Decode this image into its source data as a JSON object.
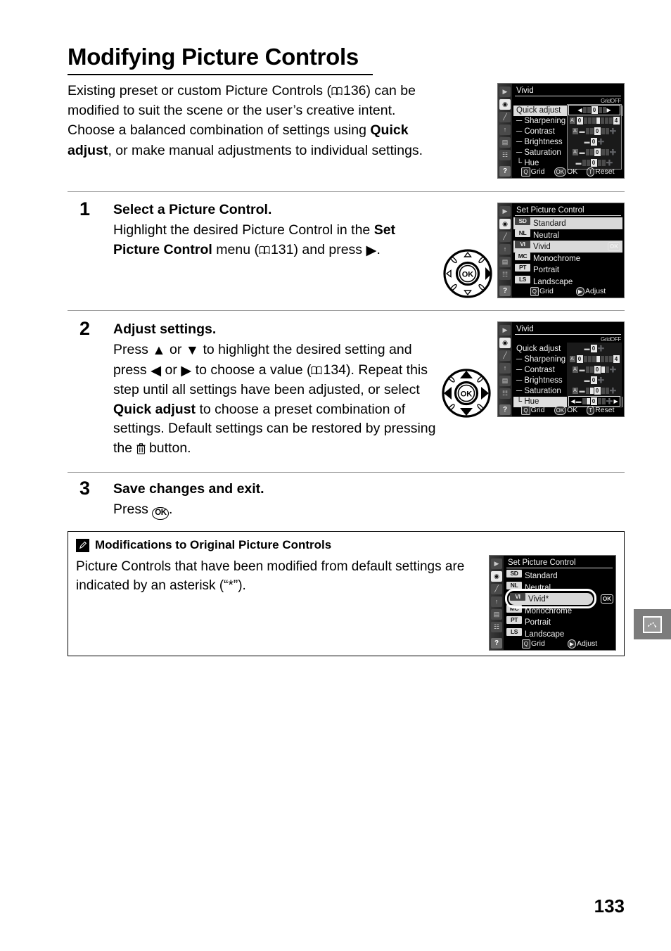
{
  "page": {
    "title": "Modifying Picture Controls",
    "page_number": "133",
    "intro_parts": {
      "a": "Existing preset or custom Picture Controls (",
      "ref": "136",
      "b": ") can be modified to suit the scene or the user’s creative intent.  Choose a balanced combination of settings using ",
      "bold": "Quick adjust",
      "c": ", or make manual adjustments to individual settings."
    }
  },
  "steps": [
    {
      "num": "1",
      "heading": "Select a Picture Control.",
      "body_a": "Highlight the desired Picture Control in the ",
      "body_bold": "Set Picture Control",
      "body_b": " menu (",
      "ref": "131",
      "body_c": ") and press ",
      "body_d": "."
    },
    {
      "num": "2",
      "heading": "Adjust settings.",
      "body_a": "Press ",
      "body_b": " or ",
      "body_c": " to highlight the desired setting and press ",
      "body_d": " or ",
      "body_e": " to choose a value (",
      "ref": "134",
      "body_f": ").  Repeat this step until all settings have been adjusted, or select ",
      "body_bold": "Quick adjust",
      "body_g": " to choose a preset combination of settings.  Default settings can be restored by pressing the ",
      "body_h": " button."
    },
    {
      "num": "3",
      "heading": "Save changes and exit.",
      "body_a": "Press ",
      "body_b": "."
    }
  ],
  "note": {
    "icon": "pencil-icon",
    "heading": "Modifications to Original Picture Controls",
    "body": "Picture Controls that have been modified from default settings are indicated by an asterisk (“*”)."
  },
  "side_tab": {
    "icon": "retouch-menu-icon"
  },
  "lcd_sidebar_icons": [
    "playback-icon",
    "shooting-menu-icon",
    "custom-settings-icon",
    "setup-menu-icon",
    "retouch-icon",
    "recent-settings-icon"
  ],
  "lcd_screens": {
    "vivid_top": {
      "title": "Vivid",
      "hi_off": "GridOFF",
      "rows": [
        {
          "label": "Quick adjust",
          "selected": true,
          "value": "0",
          "type": "quick"
        },
        {
          "label": "Sharpening",
          "selected": false,
          "value": "4",
          "type": "auto"
        },
        {
          "label": "Contrast",
          "selected": false,
          "value": "0",
          "type": "auto"
        },
        {
          "label": "Brightness",
          "selected": false,
          "value": "0",
          "type": "short"
        },
        {
          "label": "Saturation",
          "selected": false,
          "value": "0",
          "type": "auto"
        },
        {
          "label": "Hue",
          "selected": false,
          "value": "0",
          "type": "plain"
        }
      ],
      "footer": [
        {
          "badge": "Q",
          "label": "Grid"
        },
        {
          "badge": "OK",
          "label": "OK"
        },
        {
          "badge": "T",
          "label": "Reset"
        }
      ]
    },
    "set_picture_control": {
      "title": "Set Picture Control",
      "items": [
        {
          "tag": "SD",
          "label": "Standard",
          "selected": true,
          "ok": false
        },
        {
          "tag": "NL",
          "label": "Neutral",
          "selected": false,
          "ok": false
        },
        {
          "tag": "VI",
          "label": "Vivid",
          "selected": false,
          "ok": true
        },
        {
          "tag": "MC",
          "label": "Monochrome",
          "selected": false,
          "ok": false
        },
        {
          "tag": "PT",
          "label": "Portrait",
          "selected": false,
          "ok": false
        },
        {
          "tag": "LS",
          "label": "Landscape",
          "selected": false,
          "ok": false
        }
      ],
      "footer": [
        {
          "badge": "Q",
          "label": "Grid"
        },
        {
          "badge": "▶",
          "label": "Adjust"
        }
      ]
    },
    "vivid_hue": {
      "title": "Vivid",
      "hi_off": "GridOFF",
      "rows": [
        {
          "label": "Quick adjust",
          "selected": false,
          "value": "0",
          "type": "short"
        },
        {
          "label": "Sharpening",
          "selected": false,
          "value": "4",
          "type": "auto"
        },
        {
          "label": "Contrast",
          "selected": false,
          "value": "0",
          "type": "auto"
        },
        {
          "label": "Brightness",
          "selected": false,
          "value": "0",
          "type": "short"
        },
        {
          "label": "Saturation",
          "selected": false,
          "value": "0",
          "type": "auto"
        },
        {
          "label": "Hue",
          "selected": true,
          "value": "0",
          "type": "quick"
        }
      ],
      "footer": [
        {
          "badge": "Q",
          "label": "Grid"
        },
        {
          "badge": "OK",
          "label": "OK"
        },
        {
          "badge": "T",
          "label": "Reset"
        }
      ]
    },
    "modified_list": {
      "title": "Set Picture Control",
      "items": [
        {
          "tag": "SD",
          "label": "Standard",
          "selected": false,
          "ok": false,
          "dim": false
        },
        {
          "tag": "NL",
          "label": "Neutral",
          "selected": false,
          "ok": false,
          "dim": true
        },
        {
          "tag": "VI",
          "label": "Vivid*",
          "selected": true,
          "ok": true,
          "dim": false
        },
        {
          "tag": "MC",
          "label": "Monochrome",
          "selected": false,
          "ok": false,
          "dim": true
        },
        {
          "tag": "PT",
          "label": "Portrait",
          "selected": false,
          "ok": false,
          "dim": false
        },
        {
          "tag": "LS",
          "label": "Landscape",
          "selected": false,
          "ok": false,
          "dim": false
        }
      ],
      "footer": [
        {
          "badge": "Q",
          "label": "Grid"
        },
        {
          "badge": "▶",
          "label": "Adjust"
        }
      ]
    }
  }
}
